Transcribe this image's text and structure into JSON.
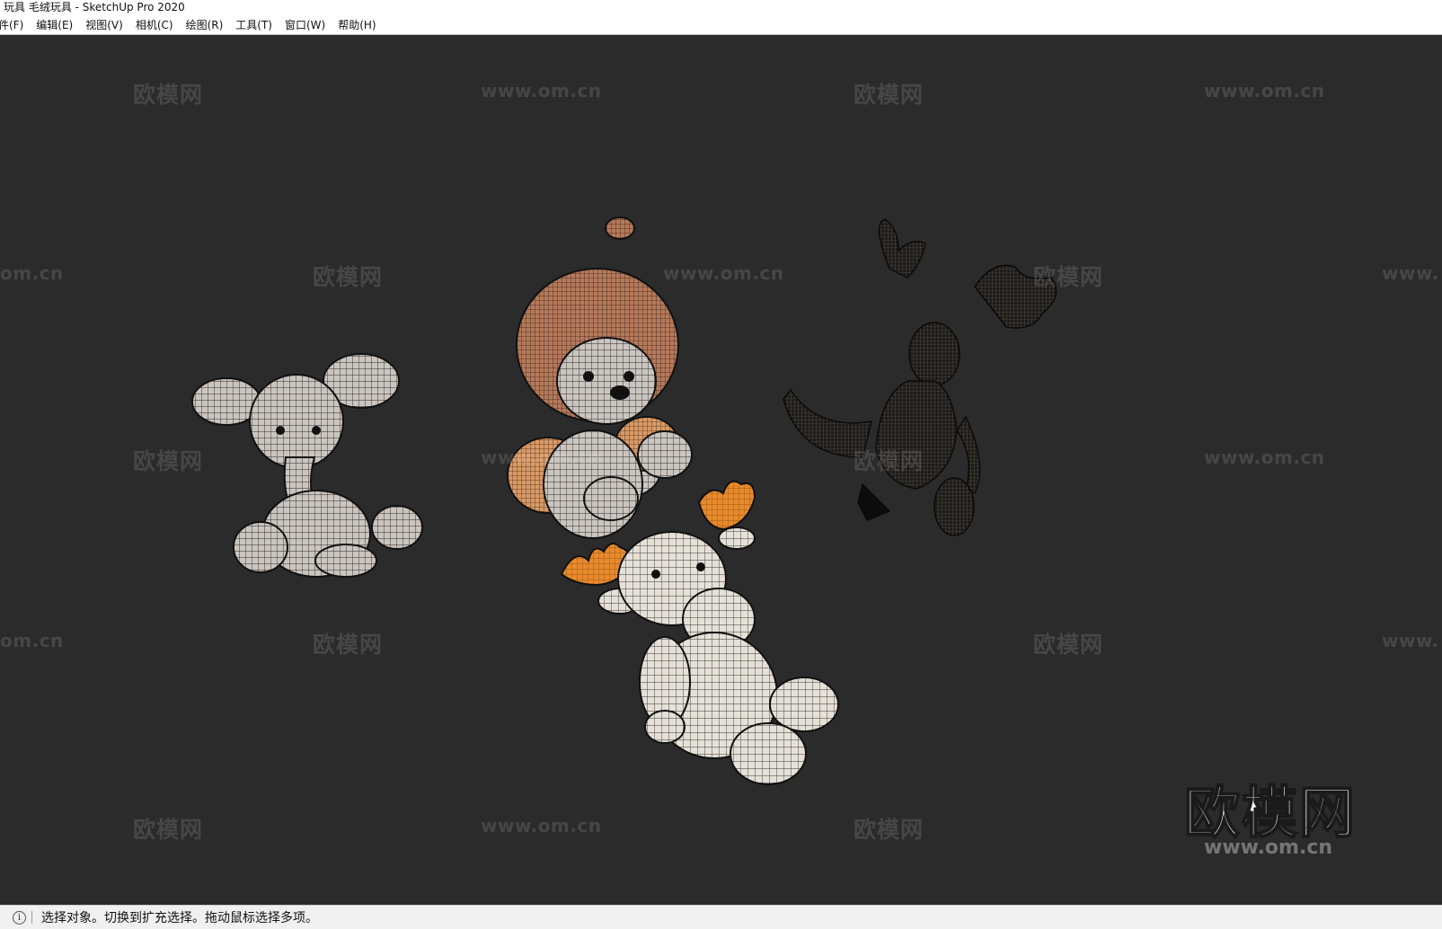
{
  "window": {
    "title": "玩具 毛绒玩具 - SketchUp Pro 2020"
  },
  "menu": {
    "items": [
      {
        "label": "件(F)"
      },
      {
        "label": "编辑(E)"
      },
      {
        "label": "视图(V)"
      },
      {
        "label": "相机(C)"
      },
      {
        "label": "绘图(R)"
      },
      {
        "label": "工具(T)"
      },
      {
        "label": "窗口(W)"
      },
      {
        "label": "帮助(H)"
      }
    ]
  },
  "watermark": {
    "brand": "欧模网",
    "url": "www.om.cn",
    "url_partial_left": "om.cn",
    "url_partial_right": "www.",
    "corner_logo": "欧模网"
  },
  "status": {
    "icon": "info-icon",
    "text": "选择对象。切换到扩充选择。拖动鼠标选择多项。"
  },
  "colors": {
    "viewport_bg": "#2b2b2b",
    "toy_white": "#e6e1d8",
    "toy_grey": "#cbc5c0",
    "toy_brown": "#b5795a",
    "toy_orange": "#e88a2c",
    "toy_dark": "#2a2622"
  }
}
